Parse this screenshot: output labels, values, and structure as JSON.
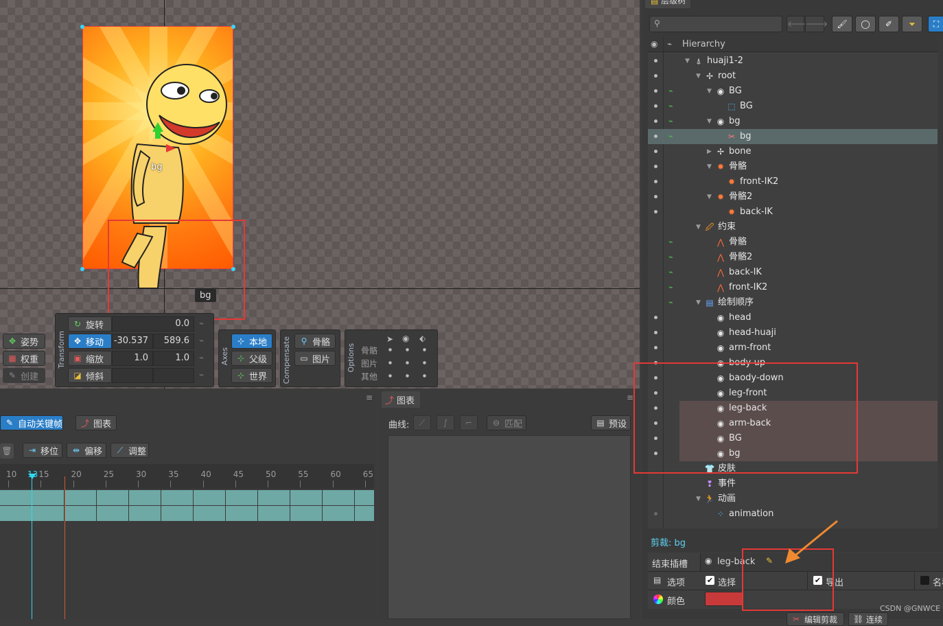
{
  "viewport": {
    "bone_label": "bg",
    "tooltip": "bg"
  },
  "toolbar_left": {
    "pose": "姿势",
    "weights": "权重",
    "create": "创建"
  },
  "transform": {
    "section": "Transform",
    "rotate_label": "旋转",
    "rotate_value": "0.0",
    "translate_label": "移动",
    "translate_x": "-30.537",
    "translate_y": "589.6",
    "scale_label": "缩放",
    "scale_x": "1.0",
    "scale_y": "1.0",
    "shear_label": "倾斜"
  },
  "axes": {
    "section": "Axes",
    "local": "本地",
    "parent": "父级",
    "world": "世界"
  },
  "compensate": {
    "section": "Compensate",
    "bones": "骨骼",
    "images": "图片"
  },
  "options": {
    "section": "Options",
    "bones": "骨骼",
    "images": "图片",
    "others": "其他"
  },
  "timeline": {
    "autokey": "自动关键帧",
    "graph": "图表",
    "offset": "移位",
    "shift": "偏移",
    "adjust": "调整",
    "current_frame": "13",
    "ticks": [
      "10",
      "15",
      "20",
      "25",
      "30",
      "35",
      "40",
      "45",
      "50",
      "55",
      "60",
      "65"
    ]
  },
  "graph": {
    "tab": "图表",
    "curve_label": "曲线:",
    "match": "匹配",
    "preset": "预设"
  },
  "hierarchy": {
    "tab": "层级树",
    "header": "Hierarchy",
    "search_placeholder": "",
    "rows": [
      {
        "label": "huaji1-2",
        "icon": "skeleton-icon",
        "glyph": "⍋",
        "depth": 0,
        "expanded": true,
        "bone": false
      },
      {
        "label": "root",
        "icon": "bone-cross-icon",
        "glyph": "✢",
        "depth": 1,
        "expanded": true,
        "bone": false
      },
      {
        "label": "BG",
        "icon": "slot-icon",
        "glyph": "◉",
        "depth": 2,
        "expanded": true,
        "bone": true
      },
      {
        "label": "BG",
        "icon": "mesh-icon",
        "glyph": "⬚",
        "depth": 3,
        "expanded": null,
        "bone": true
      },
      {
        "label": "bg",
        "icon": "slot-icon",
        "glyph": "◉",
        "depth": 2,
        "expanded": true,
        "bone": true
      },
      {
        "label": "bg",
        "icon": "clipping-icon",
        "glyph": "✂",
        "depth": 3,
        "expanded": null,
        "bone": true,
        "selected": true
      },
      {
        "label": "bone",
        "icon": "bone-cross-icon",
        "glyph": "✢",
        "depth": 2,
        "expanded": false,
        "bone": false
      },
      {
        "label": "骨骼",
        "icon": "ik-bone-icon",
        "glyph": "✹",
        "depth": 2,
        "expanded": true,
        "bone": false
      },
      {
        "label": "front-IK2",
        "icon": "ik-bone-icon",
        "glyph": "✹",
        "depth": 3,
        "expanded": null,
        "bone": false
      },
      {
        "label": "骨骼2",
        "icon": "ik-bone-icon",
        "glyph": "✹",
        "depth": 2,
        "expanded": true,
        "bone": false
      },
      {
        "label": "back-IK",
        "icon": "ik-bone-icon",
        "glyph": "✹",
        "depth": 3,
        "expanded": null,
        "bone": false
      },
      {
        "label": "约束",
        "icon": "constraint-icon",
        "glyph": "🖉",
        "depth": 1,
        "expanded": true,
        "bone": false,
        "nodot": true
      },
      {
        "label": "骨骼",
        "icon": "ik-constraint-icon",
        "glyph": "⋀",
        "depth": 2,
        "expanded": null,
        "bone": true,
        "nodot": true
      },
      {
        "label": "骨骼2",
        "icon": "ik-constraint-icon",
        "glyph": "⋀",
        "depth": 2,
        "expanded": null,
        "bone": true,
        "nodot": true
      },
      {
        "label": "back-IK",
        "icon": "ik-constraint-icon",
        "glyph": "⋀",
        "depth": 2,
        "expanded": null,
        "bone": true,
        "nodot": true
      },
      {
        "label": "front-IK2",
        "icon": "ik-constraint-icon",
        "glyph": "⋀",
        "depth": 2,
        "expanded": null,
        "bone": true,
        "nodot": true
      },
      {
        "label": "绘制顺序",
        "icon": "draw-order-icon",
        "glyph": "▤",
        "depth": 1,
        "expanded": true,
        "bone": true,
        "nodot": true
      },
      {
        "label": "head",
        "icon": "slot-icon",
        "glyph": "◉",
        "depth": 2,
        "expanded": null,
        "bone": false
      },
      {
        "label": "head-huaji",
        "icon": "slot-icon",
        "glyph": "◉",
        "depth": 2,
        "expanded": null,
        "bone": false
      },
      {
        "label": "arm-front",
        "icon": "slot-icon",
        "glyph": "◉",
        "depth": 2,
        "expanded": null,
        "bone": false
      },
      {
        "label": "body-up",
        "icon": "slot-icon",
        "glyph": "◉",
        "depth": 2,
        "expanded": null,
        "bone": false
      },
      {
        "label": "baody-down",
        "icon": "slot-icon",
        "glyph": "◉",
        "depth": 2,
        "expanded": null,
        "bone": false
      },
      {
        "label": "leg-front",
        "icon": "slot-icon",
        "glyph": "◉",
        "depth": 2,
        "expanded": null,
        "bone": false
      },
      {
        "label": "leg-back",
        "icon": "slot-icon",
        "glyph": "◉",
        "depth": 2,
        "expanded": null,
        "bone": false,
        "clipped": true
      },
      {
        "label": "arm-back",
        "icon": "slot-icon",
        "glyph": "◉",
        "depth": 2,
        "expanded": null,
        "bone": false,
        "clipped": true
      },
      {
        "label": "BG",
        "icon": "slot-icon",
        "glyph": "◉",
        "depth": 2,
        "expanded": null,
        "bone": false,
        "clipped": true
      },
      {
        "label": "bg",
        "icon": "slot-icon",
        "glyph": "◉",
        "depth": 2,
        "expanded": null,
        "bone": false,
        "clipped": true
      },
      {
        "label": "皮肤",
        "icon": "skin-icon",
        "glyph": "👕",
        "depth": 1,
        "expanded": null,
        "bone": false,
        "nodot": true
      },
      {
        "label": "事件",
        "icon": "event-icon",
        "glyph": "❢",
        "depth": 1,
        "expanded": null,
        "bone": false,
        "nodot": true
      },
      {
        "label": "动画",
        "icon": "animation-icon",
        "glyph": "🏃",
        "depth": 1,
        "expanded": true,
        "bone": false,
        "nodot": true
      },
      {
        "label": "animation",
        "icon": "animation-item-icon",
        "glyph": "⁘",
        "depth": 2,
        "expanded": null,
        "bone": false,
        "faint": true
      }
    ]
  },
  "properties": {
    "title": "剪裁: bg",
    "end_slot_label": "结束插槽",
    "end_slot_value": "leg-back",
    "options_label": "选项",
    "select_label": "选择",
    "export_label": "导出",
    "name_label": "名称",
    "color_label": "颜色",
    "color_value": "#c83a3a"
  },
  "bottom_buttons": {
    "edit_clip": "编辑剪裁",
    "link": "连续"
  },
  "watermark": "CSDN @GNWCE",
  "colors": {
    "accent": "#2a7ec7",
    "highlight": "#e53935",
    "selected_row": "#5a6a6a",
    "clipped_row": "#5c4d4d"
  }
}
